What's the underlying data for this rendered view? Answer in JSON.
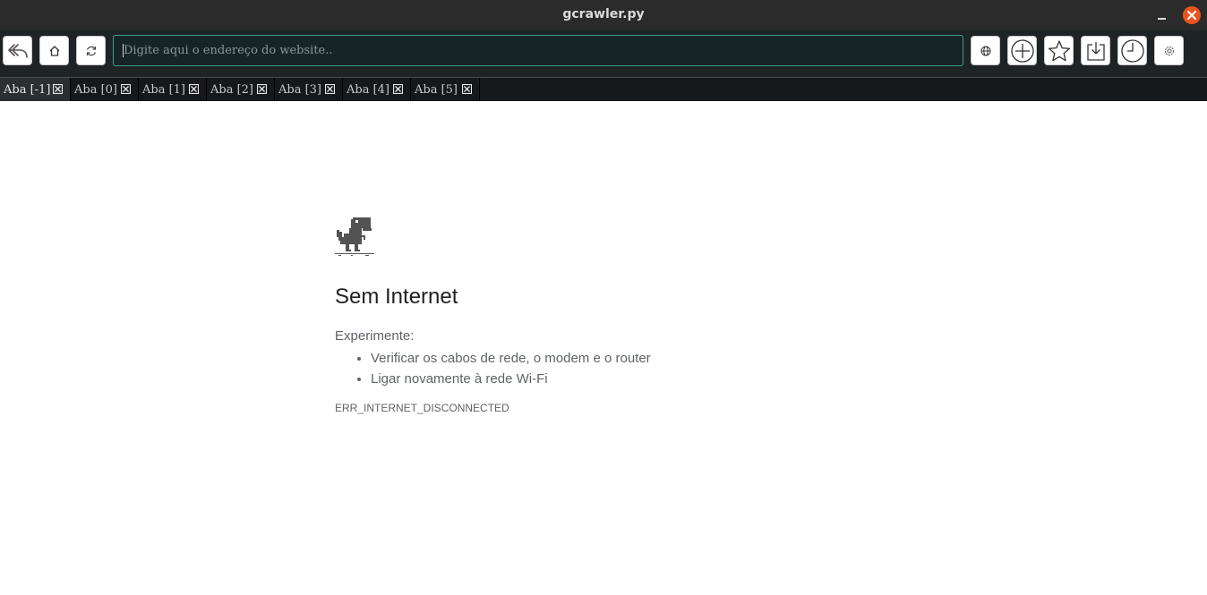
{
  "window": {
    "title": "gcrawler.py"
  },
  "toolbar": {
    "url_placeholder": "Digite aqui o  endereço do website.."
  },
  "tabs": [
    {
      "label": "Aba [-1]",
      "active": true
    },
    {
      "label": "Aba [0]",
      "active": false
    },
    {
      "label": "Aba [1]",
      "active": false
    },
    {
      "label": "Aba [2]",
      "active": false
    },
    {
      "label": "Aba [3]",
      "active": false
    },
    {
      "label": "Aba [4]",
      "active": false
    },
    {
      "label": "Aba [5]",
      "active": false
    }
  ],
  "error_page": {
    "heading": "Sem Internet",
    "try_label": "Experimente:",
    "suggestions": [
      "Verificar os cabos de rede, o modem e o router",
      "Ligar novamente à rede Wi-Fi"
    ],
    "error_code": "ERR_INTERNET_DISCONNECTED"
  },
  "icons": {
    "back": "undo-arrow-icon",
    "home": "home-icon",
    "reload": "reload-icon",
    "globe": "globe-icon",
    "new_tab": "plus-circle-icon",
    "bookmark": "star-icon",
    "download": "download-icon",
    "history": "clock-icon",
    "settings": "gear-icon",
    "tab_close": "close-box-icon",
    "offline": "dinosaur-icon"
  },
  "colors": {
    "titlebar": "#2b2b2b",
    "toolbar": "#1e2325",
    "close_button": "#e95420",
    "url_border": "#3f9c8a",
    "tabs_bar": "#16191b"
  }
}
